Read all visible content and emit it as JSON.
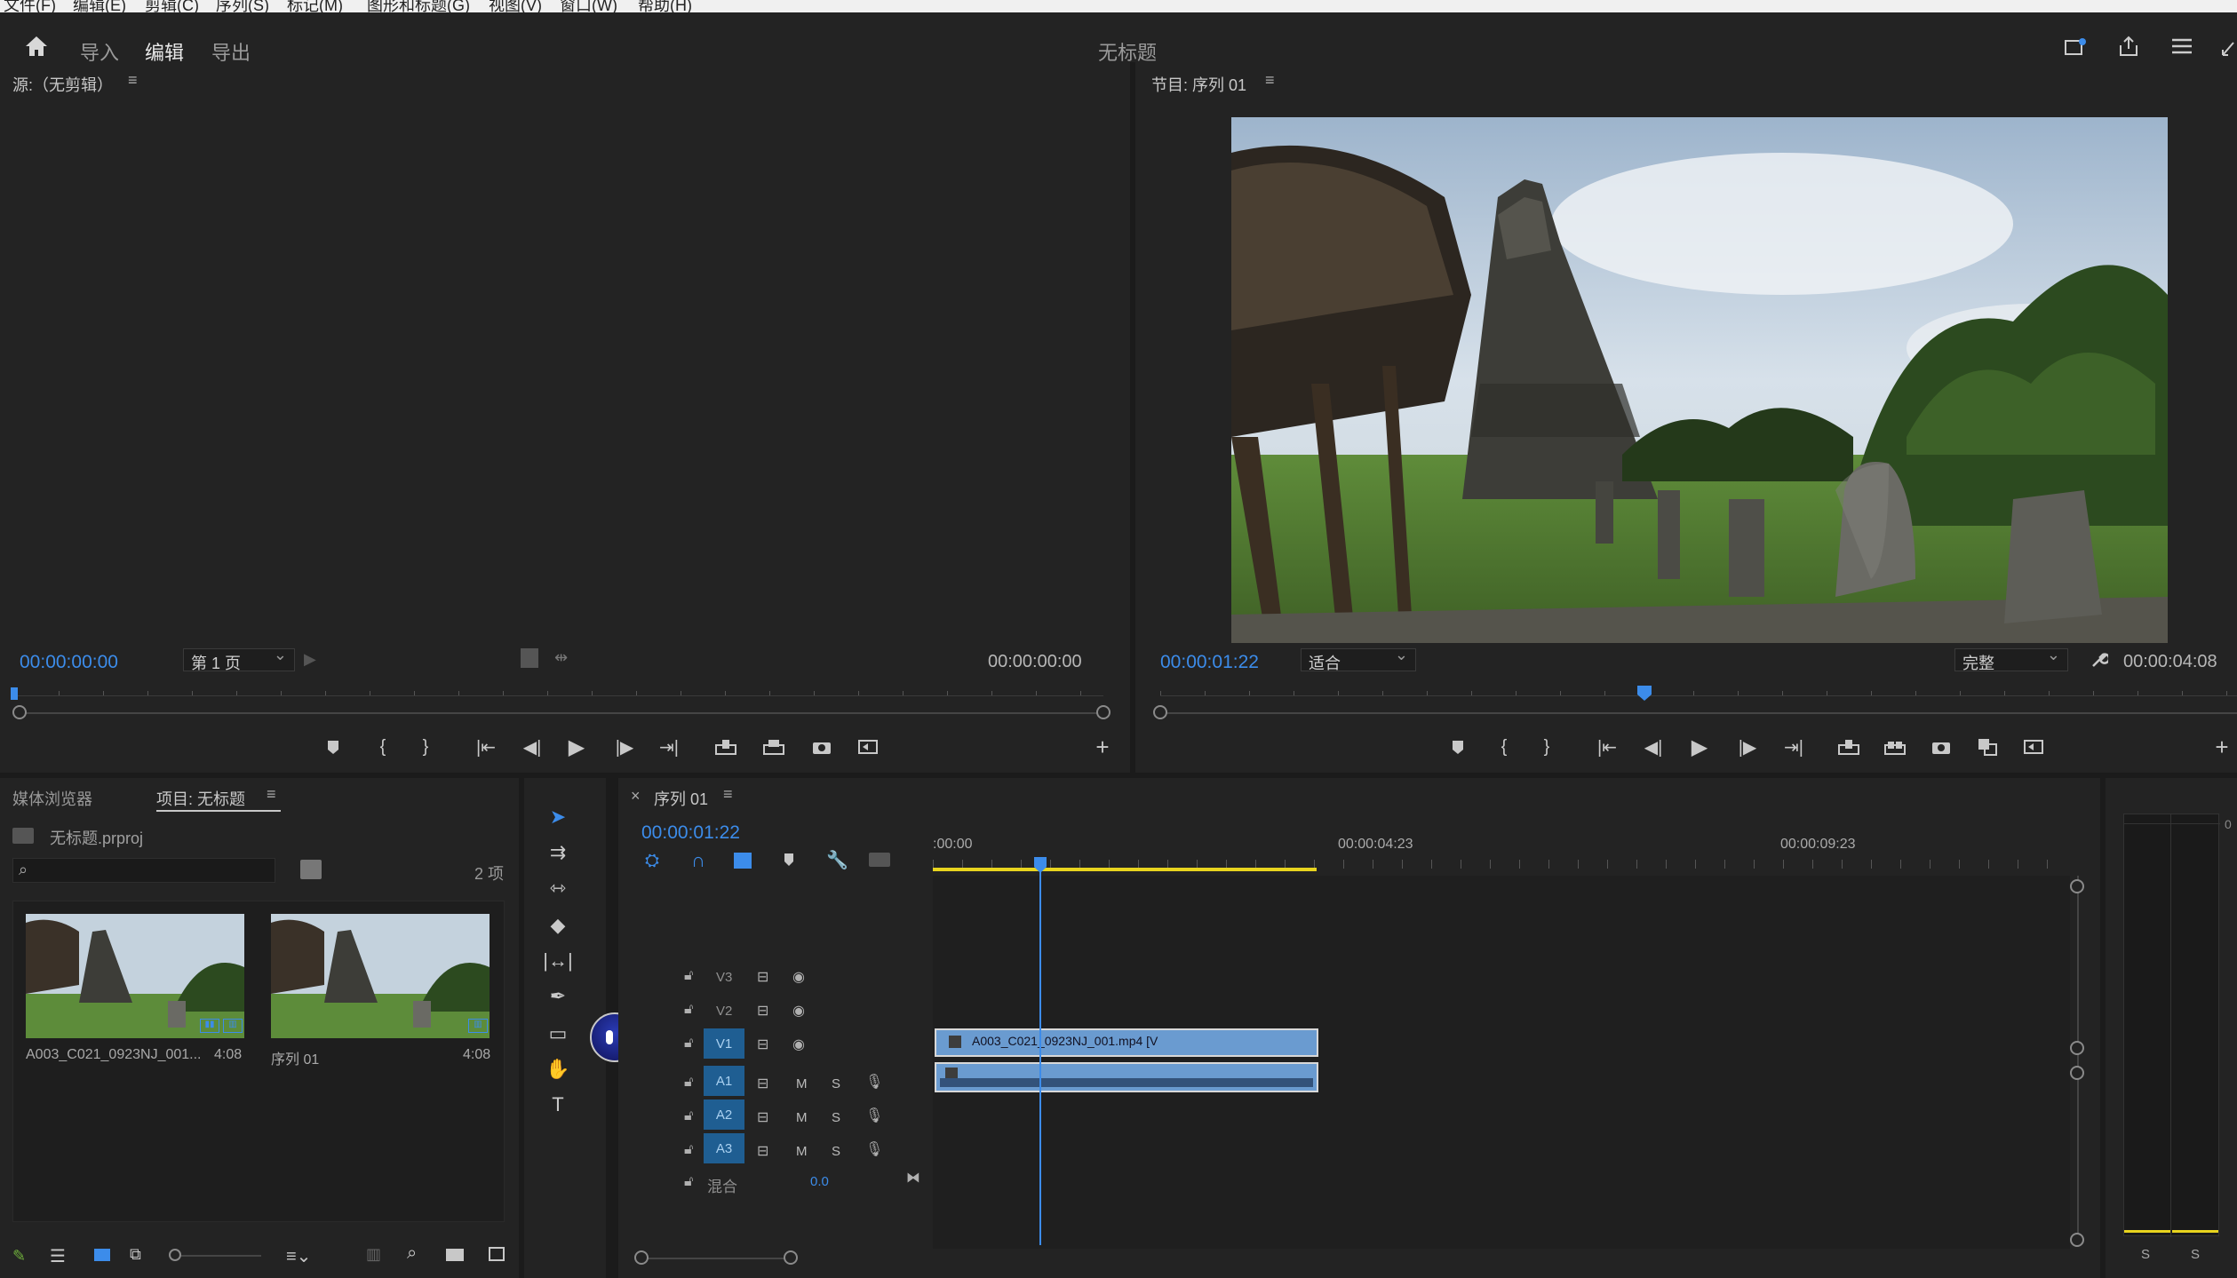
{
  "menubar": {
    "items": [
      "文件(F)",
      "编辑(E)",
      "剪辑(C)",
      "序列(S)",
      "标记(M)",
      "图形和标题(G)",
      "视图(V)",
      "窗口(W)",
      "帮助(H)"
    ]
  },
  "header": {
    "tabs": [
      {
        "label": "导入"
      },
      {
        "label": "编辑"
      },
      {
        "label": "导出"
      }
    ],
    "active_tab": "编辑",
    "doc_title": "无标题"
  },
  "source_monitor": {
    "title": "源:（无剪辑）",
    "menu_icon": "≡",
    "timecode_in": "00:00:00:00",
    "page_select": "第 1 页",
    "timecode_out": "00:00:00:00"
  },
  "program_monitor": {
    "title": "节目: 序列 01",
    "menu_icon": "≡",
    "timecode_in": "00:00:01:22",
    "fit_select": "适合",
    "quality_select": "完整",
    "timecode_out": "00:00:04:08"
  },
  "project_panel": {
    "tabs": [
      {
        "label": "媒体浏览器"
      },
      {
        "label": "项目: 无标题"
      }
    ],
    "menu_icon": "≡",
    "project_file": "无标题.prproj",
    "search_placeholder": "",
    "item_count": "2 项",
    "items": [
      {
        "name": "A003_C021_0923NJ_001...",
        "duration": "4:08"
      },
      {
        "name": "序列 01",
        "duration": "4:08"
      }
    ]
  },
  "timeline": {
    "close_icon": "×",
    "tab_label": "序列 01",
    "menu_icon": "≡",
    "timecode": "00:00:01:22",
    "ruler_labels": [
      ":00:00",
      "00:00:04:23",
      "00:00:09:23"
    ],
    "tracks": {
      "video": [
        {
          "label": "V3"
        },
        {
          "label": "V2"
        },
        {
          "label": "V1"
        }
      ],
      "audio": [
        {
          "label": "A1",
          "m": "M",
          "s": "S"
        },
        {
          "label": "A2",
          "m": "M",
          "s": "S"
        },
        {
          "label": "A3",
          "m": "M",
          "s": "S"
        }
      ],
      "mix": {
        "label": "混合",
        "value": "0.0"
      }
    },
    "video_clip_label": "A003_C021_0923NJ_001.mp4 [V",
    "playhead_time": "00:00:01:22"
  },
  "audio_meter": {
    "solo_labels": [
      "S",
      "S"
    ],
    "scale_top": "0"
  },
  "colors": {
    "accent": "#3c8cea",
    "clip_video": "#6a9bd0",
    "track_target": "#1f5e92",
    "work_area": "#e8d41e"
  },
  "progress": {
    "program_playhead_fraction": 0.45,
    "timeline_playhead_fraction": 0.4
  }
}
